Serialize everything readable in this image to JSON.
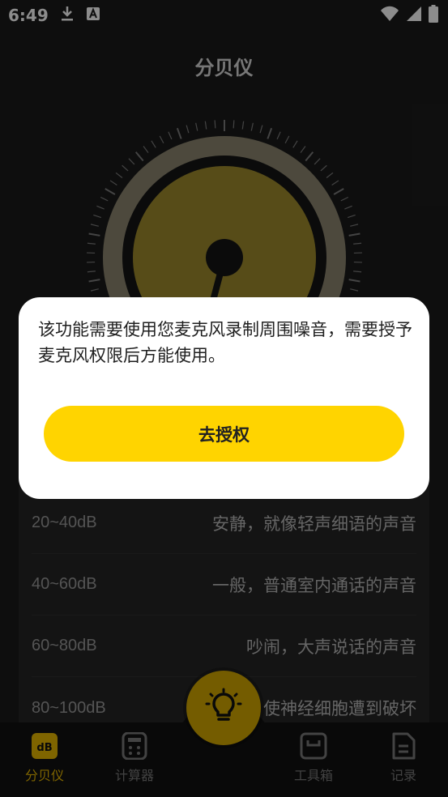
{
  "status_bar": {
    "time": "6:49",
    "icons": [
      "download-icon",
      "app-a-icon",
      "wifi-icon",
      "signal-icon",
      "battery-icon"
    ]
  },
  "header": {
    "title": "分贝仪"
  },
  "gauge": {
    "colors": {
      "outer": "#8c8670",
      "inner": "#9e8a2d",
      "center": "#141414"
    }
  },
  "scale_list": [
    {
      "range": "20~40dB",
      "description": "安静，就像轻声细语的声音"
    },
    {
      "range": "40~60dB",
      "description": "一般，普通室内通话的声音"
    },
    {
      "range": "60~80dB",
      "description": "吵闹，大声说话的声音"
    },
    {
      "range": "80~100dB",
      "description": "使神经细胞遭到破坏"
    }
  ],
  "dialog": {
    "message": "该功能需要使用您麦克风录制周围噪音，需要授予麦克风权限后方能使用。",
    "button_label": "去授权"
  },
  "bottom_nav": {
    "items": [
      {
        "label": "分贝仪",
        "icon": "db-meter-icon",
        "active": true
      },
      {
        "label": "计算器",
        "icon": "calculator-icon",
        "active": false
      },
      {
        "label": "工具箱",
        "icon": "toolbox-icon",
        "active": false
      },
      {
        "label": "记录",
        "icon": "record-icon",
        "active": false
      }
    ],
    "center_button_icon": "light-bulb-icon"
  },
  "colors": {
    "accent": "#ffd400",
    "background": "#1b1b1b"
  }
}
